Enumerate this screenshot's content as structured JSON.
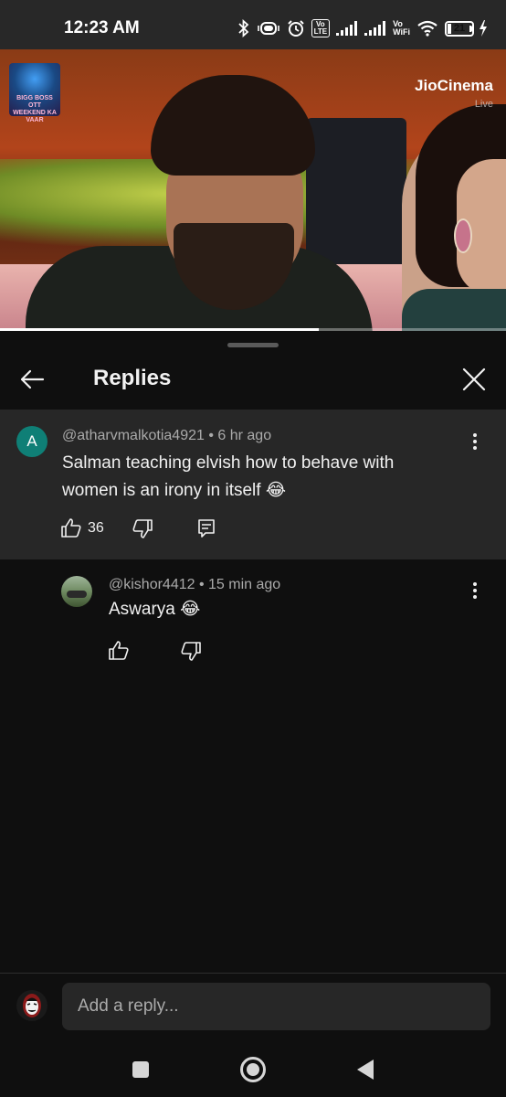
{
  "status_bar": {
    "time": "12:23 AM",
    "volte_tag_1": "Vo\nLTE",
    "vo_wifi": "Vo\nWiFi",
    "battery_level": "21",
    "battery_fraction": 0.21,
    "icons": [
      "bluetooth-icon",
      "vibrate-icon",
      "alarm-icon",
      "volte-icon",
      "signal-icon",
      "signal-icon",
      "vowifi-icon",
      "wifi-icon",
      "battery-icon",
      "charging-icon"
    ]
  },
  "video": {
    "brand": "JioCinema",
    "live_label": "Live",
    "logo_text": "BIGG BOSS OTT\nWEEKEND KA VAAR",
    "progress_fraction": 0.63
  },
  "panel": {
    "title": "Replies",
    "back_icon": "arrow-left-icon",
    "close_icon": "close-icon"
  },
  "main_comment": {
    "avatar_letter": "A",
    "avatar_color": "#0f7f76",
    "author": "@atharvmalkotia4921",
    "time": "6 hr ago",
    "text": "Salman teaching elvish how to behave with women is an irony in itself 😂",
    "like_count": "36"
  },
  "reply": {
    "author": "@kishor4412",
    "time": "15 min ago",
    "text": "Aswarya 😂"
  },
  "input": {
    "placeholder": "Add a reply..."
  },
  "nav": {
    "icons": [
      "recents-square-icon",
      "home-circle-icon",
      "back-triangle-icon"
    ]
  }
}
